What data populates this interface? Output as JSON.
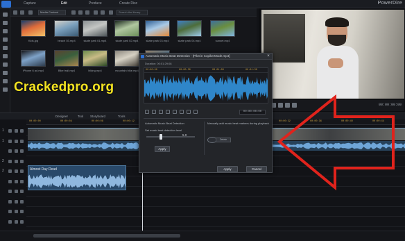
{
  "app": {
    "brand": "PowerDire",
    "menu_tabs": [
      "Capture",
      "Edit",
      "Produce",
      "Create Disc"
    ],
    "active_tab": "Edit"
  },
  "library": {
    "select_value": "Media Content",
    "search_placeholder": "Search the library",
    "thumbnails": [
      {
        "label": "Kids.jpg",
        "colors": [
          "#1b3f6e",
          "#f1c26a",
          "#e06c3a"
        ]
      },
      {
        "label": "beach 03.mp4",
        "colors": [
          "#d2cfc7",
          "#3a5a74",
          "#7ba0bd"
        ]
      },
      {
        "label": "skate park 01.mp4",
        "colors": [
          "#8a8f92",
          "#4e5559",
          "#c4c6c4"
        ]
      },
      {
        "label": "skate park 02.mp4",
        "colors": [
          "#1d2a1f",
          "#6c8f5a",
          "#b0c7a0"
        ]
      },
      {
        "label": "skate park 03.mp4",
        "colors": [
          "#2f5f94",
          "#e38a3a",
          "#a9c9e6"
        ]
      },
      {
        "label": "skate park 04.mp4",
        "colors": [
          "#3f7fc4",
          "#9cc8e9",
          "#4d6d3a"
        ]
      },
      {
        "label": "sunset.mp4",
        "colors": [
          "#3d6f9d",
          "#7fb4e0",
          "#6a8e3f"
        ]
      },
      {
        "label": "iPhone 6 ad.mp4",
        "colors": [
          "#141518",
          "#2d3c4e",
          "#7ea2c8"
        ]
      },
      {
        "label": "Bike trail.mp4",
        "colors": [
          "#5b4330",
          "#a9854f",
          "#3a5f3d"
        ]
      },
      {
        "label": "hiking.mp4",
        "colors": [
          "#6b8a4c",
          "#2d4a25",
          "#c9bb86"
        ]
      },
      {
        "label": "mountain bike.mp4",
        "colors": [
          "#8a857c",
          "#4a453d",
          "#d7d2c5"
        ]
      },
      {
        "label": "Beach Photo.mp4",
        "colors": [
          "#b79f82",
          "#e2cdae",
          "#6a8ca6"
        ]
      }
    ]
  },
  "preview": {
    "timecode": "00:00:00:00"
  },
  "timeline": {
    "tabs": [
      "Designer",
      "Tool",
      "Storyboard",
      "Fx",
      "Tools",
      "Clip"
    ],
    "ruler_ticks": [
      "00:00:00",
      "00:00:04",
      "00:00:08",
      "00:00:12",
      "00:00:16",
      "00:00:20",
      "00:00:24",
      "00:00:28",
      "00:00:32",
      "00:00:36",
      "00:00:40",
      "00:00:44"
    ],
    "tracks": [
      "1",
      "1",
      "",
      "2",
      "2",
      "",
      "",
      "",
      "",
      ""
    ],
    "music_clip_name": "Almost Day Dead"
  },
  "dialog": {
    "title": "Automatic Music Beat Detection - [Pilot in Copilot Mode.mp4]",
    "duration": "Duration: 00:01:29:08",
    "close": "×",
    "wave_ticks": [
      "00:00:00",
      "00:00:30",
      "00:01:00",
      "00:01:30"
    ],
    "timecode": "00:00:00:00",
    "auto_label": "Automatic Music Beat Detection",
    "level_label": "Set music beat detection level",
    "slider_value": "5.0",
    "slider_level": 0.3,
    "apply_label": "Apply",
    "manual_label": "Manually add music beat markers during playback",
    "delete_label": "Delete",
    "ok_label": "Apply",
    "cancel_label": "Cancel"
  },
  "overlay": {
    "watermark": "Crackedpro.org",
    "arrow_color": "#e0231c"
  }
}
